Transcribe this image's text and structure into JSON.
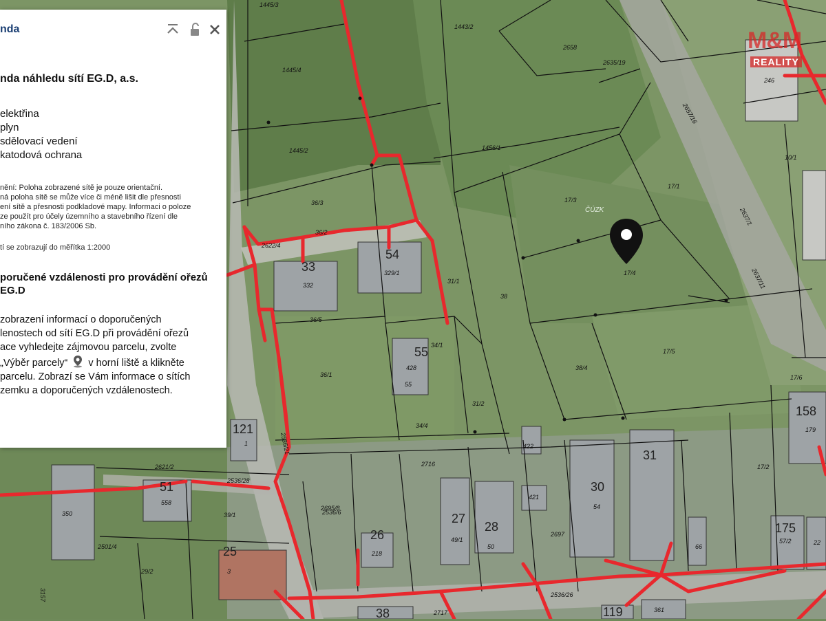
{
  "legend": {
    "title": "nda",
    "heading": "nda náhledu sítí EG.D, a.s.",
    "items": [
      "elektřina",
      "plyn",
      "sdělovací vedení",
      "katodová ochrana"
    ],
    "disclaimer": [
      "nění: Poloha zobrazené sítě je pouze orientační.",
      "ná poloha sítě se může více či méně lišit dle přesnosti",
      "ení sítě a přesnosti podkladové mapy. Informaci o poloze",
      "ze použít pro účely územního a stavebního řízení dle",
      "ního zákona č. 183/2006 Sb."
    ],
    "scale_note": "tí se zobrazují do měřítka 1:2000",
    "subheading": [
      "poručené vzdálenosti pro provádění ořezů",
      "EG.D"
    ],
    "info": [
      "zobrazení informací o doporučených",
      "lenostech od sítí EG.D při provádění ořezů",
      "ace vyhledejte zájmovou parcelu, zvolte",
      "„Výběr parcely“",
      "v horní liště a klikněte",
      "parcelu. Zobrazí se Vám informace o sítích",
      "zemku a doporučených vzdálenostech."
    ]
  },
  "watermark": {
    "big": "M&M",
    "small": "REALITY"
  },
  "map": {
    "parcel_labels": [
      "1445/3",
      "1443/2",
      "2658",
      "2635/19",
      "2657/16",
      "246",
      "1445/4",
      "1445/2",
      "1456/1",
      "17/3",
      "17/1",
      "10/1",
      "36/3",
      "36/2",
      "2622/4",
      "332",
      "329/1",
      "31/1",
      "38",
      "17/4",
      "2637/1",
      "2637/11",
      "36/5",
      "428",
      "36/1",
      "34/1",
      "38/4",
      "17/5",
      "17/6",
      "179",
      "31/2",
      "34/4",
      "422",
      "55",
      "17/2",
      "2716",
      "421",
      "558",
      "2536/28",
      "2621/2",
      "2536/21",
      "350",
      "39/1",
      "2536/6",
      "2501/4",
      "3",
      "29/2",
      "218",
      "49/1",
      "50",
      "2697",
      "54",
      "66",
      "57/2",
      "25",
      "22",
      "2717",
      "2536/26",
      "361",
      "3157",
      "2695/8",
      "1"
    ],
    "house_numbers": [
      "33",
      "54",
      "55",
      "121",
      "158",
      "51",
      "27",
      "28",
      "26",
      "30",
      "31",
      "175",
      "25",
      "38",
      "119"
    ],
    "watermark_text": "ČÚZK"
  },
  "colors": {
    "network_red": "#e8282d",
    "legend_title": "#1b3f73"
  }
}
